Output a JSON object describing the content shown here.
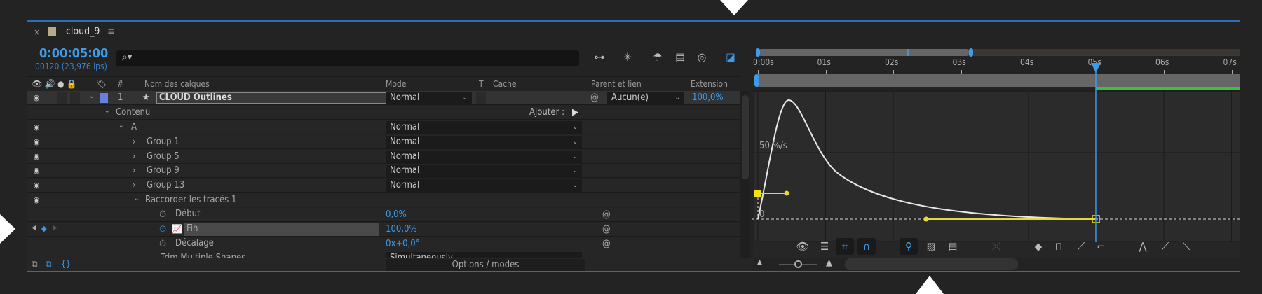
{
  "comp": {
    "tab_name": "cloud_9",
    "close": "×",
    "menu": "≡",
    "timecode": "0:00:05:00",
    "frames": "00120 (23,976 ips)",
    "search_placeholder": "⌕▾"
  },
  "columns": {
    "name": "Nom des calques",
    "num": "#",
    "mode": "Mode",
    "t": "T",
    "cache": "Cache",
    "parent": "Parent et lien",
    "extension": "Extension"
  },
  "layer": {
    "num": "1",
    "name": "CLOUD Outlines",
    "mode": "Normal",
    "parent": "Aucun(e)",
    "extension": "100,0%",
    "label_color": "#6b7fe0"
  },
  "content": {
    "label": "Contenu",
    "add": "Ajouter :"
  },
  "groups": [
    {
      "name": "A",
      "mode": "Normal"
    },
    {
      "name": "Group 1",
      "mode": "Normal"
    },
    {
      "name": "Group 5",
      "mode": "Normal"
    },
    {
      "name": "Group 9",
      "mode": "Normal"
    },
    {
      "name": "Group 13",
      "mode": "Normal"
    }
  ],
  "trim": {
    "label": "Raccorder les tracés 1",
    "props": [
      {
        "name": "Début",
        "value": "0,0%"
      },
      {
        "name": "Fin",
        "value": "100,0%"
      },
      {
        "name": "Décalage",
        "value": "0x+0,0°"
      }
    ],
    "multi_label": "Trim Multiple Shapes",
    "multi_value": "Simultaneously"
  },
  "bottom": {
    "toggle_label": "Options / modes"
  },
  "timeline": {
    "ticks": [
      "0:00s",
      "01s",
      "02s",
      "03s",
      "04s",
      "05s",
      "06s",
      "07s"
    ],
    "current_time_s": 5
  },
  "graph": {
    "y_label": "50 %/s",
    "zero_label": "0",
    "keyframes_s": [
      0,
      5
    ],
    "curve_color": "#e8e8e8",
    "handle_color": "#e8d63a"
  },
  "colors": {
    "accent": "#3d9be9",
    "work_area": "#3fbf3f"
  }
}
